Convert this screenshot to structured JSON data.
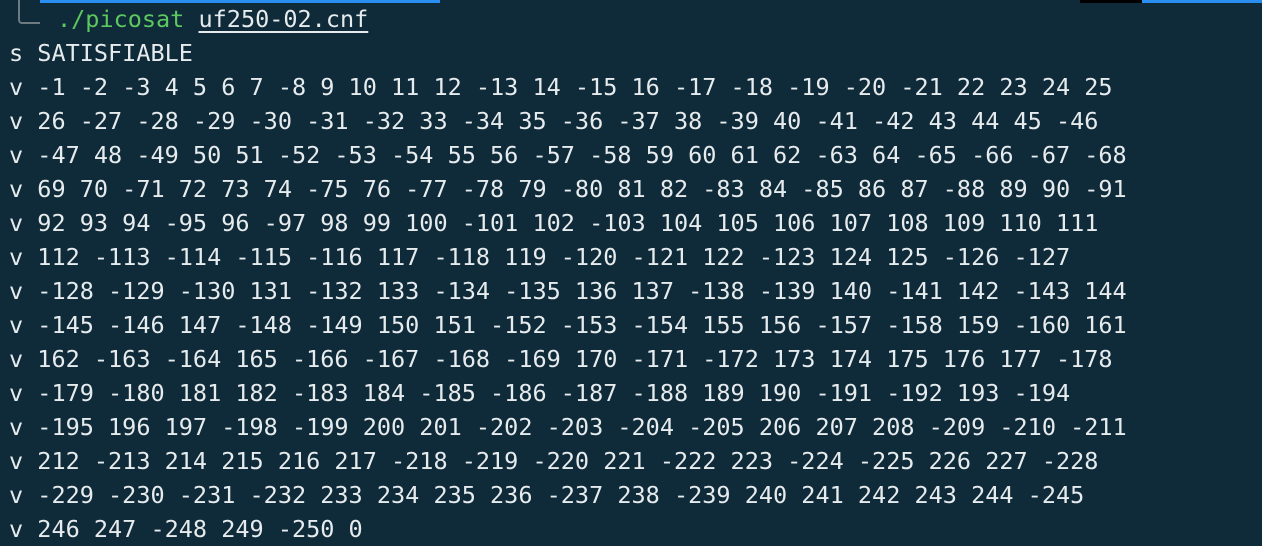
{
  "prompt": {
    "command": "./picosat",
    "argument": "uf250-02.cnf"
  },
  "output": {
    "lines": [
      "s SATISFIABLE",
      "v -1 -2 -3 4 5 6 7 -8 9 10 11 12 -13 14 -15 16 -17 -18 -19 -20 -21 22 23 24 25",
      "v 26 -27 -28 -29 -30 -31 -32 33 -34 35 -36 -37 38 -39 40 -41 -42 43 44 45 -46",
      "v -47 48 -49 50 51 -52 -53 -54 55 56 -57 -58 59 60 61 62 -63 64 -65 -66 -67 -68",
      "v 69 70 -71 72 73 74 -75 76 -77 -78 79 -80 81 82 -83 84 -85 86 87 -88 89 90 -91",
      "v 92 93 94 -95 96 -97 98 99 100 -101 102 -103 104 105 106 107 108 109 110 111",
      "v 112 -113 -114 -115 -116 117 -118 119 -120 -121 122 -123 124 125 -126 -127",
      "v -128 -129 -130 131 -132 133 -134 -135 136 137 -138 -139 140 -141 142 -143 144",
      "v -145 -146 147 -148 -149 150 151 -152 -153 -154 155 156 -157 -158 159 -160 161",
      "v 162 -163 -164 165 -166 -167 -168 -169 170 -171 -172 173 174 175 176 177 -178",
      "v -179 -180 181 182 -183 184 -185 -186 -187 -188 189 190 -191 -192 193 -194",
      "v -195 196 197 -198 -199 200 201 -202 -203 -204 -205 206 207 208 -209 -210 -211",
      "v 212 -213 214 215 216 217 -218 -219 -220 221 -222 223 -224 -225 226 227 -228",
      "v -229 -230 -231 -232 233 234 235 236 -237 238 -239 240 241 242 243 244 -245",
      "v 246 247 -248 249 -250 0"
    ]
  },
  "colors": {
    "background": "#0f2a38",
    "text": "#e6ebee",
    "command": "#5cc85f",
    "accent": "#2a8df0"
  }
}
